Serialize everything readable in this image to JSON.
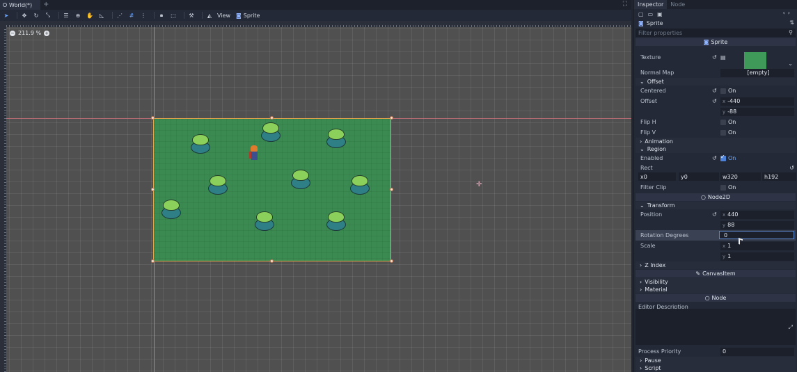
{
  "viewport": {
    "tab_title": "World(*)",
    "tab_add": "+",
    "maximize": "⛶",
    "toolbar": {
      "view_label": "View",
      "sprite_label": "Sprite"
    },
    "zoom": {
      "minus": "−",
      "value": "211.9 %",
      "plus": "+"
    }
  },
  "inspector": {
    "tabs": [
      "Inspector",
      "Node"
    ],
    "object_name": "Sprite",
    "filter_placeholder": "Filter properties",
    "sections": {
      "sprite": "Sprite",
      "node2d": "Node2D",
      "canvasitem": "CanvasItem",
      "node": "Node"
    },
    "props": {
      "texture": "Texture",
      "normal_map": "Normal Map",
      "normal_map_value": "[empty]",
      "offset_group": "Offset",
      "centered": "Centered",
      "centered_value": "On",
      "offset": "Offset",
      "offset_x": "-440",
      "offset_y": "-88",
      "flip_h": "Flip H",
      "flip_h_value": "On",
      "flip_v": "Flip V",
      "flip_v_value": "On",
      "animation_group": "Animation",
      "region_group": "Region",
      "enabled": "Enabled",
      "enabled_value": "On",
      "rect": "Rect",
      "rect_x": "0",
      "rect_y": "0",
      "rect_w": "320",
      "rect_h": "192",
      "filter_clip": "Filter Clip",
      "filter_clip_value": "On",
      "transform_group": "Transform",
      "position": "Position",
      "position_x": "440",
      "position_y": "88",
      "rotation": "Rotation Degrees",
      "rotation_value": "0",
      "scale": "Scale",
      "scale_x": "1",
      "scale_y": "1",
      "z_index_group": "Z Index",
      "visibility_group": "Visibility",
      "material_group": "Material",
      "editor_description": "Editor Description",
      "process_priority": "Process Priority",
      "process_priority_value": "0",
      "pause_group": "Pause",
      "script_group": "Script"
    },
    "axis_labels": {
      "x": "x",
      "y": "y",
      "w": "w",
      "h": "h"
    }
  }
}
